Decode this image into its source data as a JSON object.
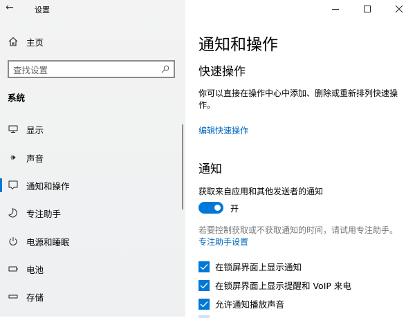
{
  "window": {
    "title": "设置",
    "controls": [
      "minimize",
      "maximize",
      "close"
    ]
  },
  "sidebar": {
    "home": "主页",
    "search_placeholder": "查找设置",
    "section": "系统",
    "items": [
      {
        "label": "显示",
        "icon": "monitor-icon"
      },
      {
        "label": "声音",
        "icon": "speaker-icon"
      },
      {
        "label": "通知和操作",
        "icon": "message-icon",
        "selected": true
      },
      {
        "label": "专注助手",
        "icon": "moon-icon"
      },
      {
        "label": "电源和睡眠",
        "icon": "power-icon"
      },
      {
        "label": "电池",
        "icon": "battery-icon"
      },
      {
        "label": "存储",
        "icon": "storage-icon"
      }
    ]
  },
  "main": {
    "title": "通知和操作",
    "quick_heading": "快速操作",
    "quick_desc": "你可以直接在操作中心中添加、删除或重新排列快速操作。",
    "quick_link": "编辑快速操作",
    "notif_heading": "通知",
    "notif_label": "获取来自应用和其他发送者的通知",
    "toggle_state": "开",
    "toggle_on": true,
    "focus_desc": "若要控制获取或不获取通知的时间，请试用专注助手。",
    "focus_link": "专注助手设置",
    "checkboxes": [
      {
        "label": "在锁屏界面上显示通知",
        "checked": true
      },
      {
        "label": "在锁屏界面上显示提醒和 VoIP 来电",
        "checked": true
      },
      {
        "label": "允许通知播放声音",
        "checked": true
      }
    ]
  },
  "colors": {
    "accent": "#0078d7",
    "link": "#0067c0"
  }
}
